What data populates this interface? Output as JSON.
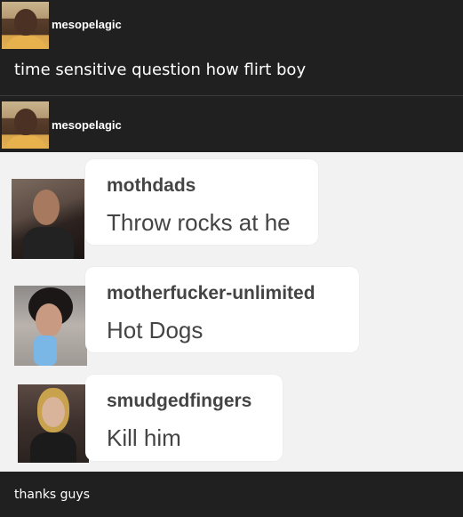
{
  "posts": [
    {
      "username": "mesopelagic",
      "text": "time sensitive question how flirt boy"
    },
    {
      "username": "mesopelagic"
    }
  ],
  "replies": [
    {
      "username": "mothdads",
      "message": "Throw rocks at he"
    },
    {
      "username": "motherfucker-unlimited",
      "message": "Hot Dogs"
    },
    {
      "username": "smudgedfingers",
      "message": "Kill him"
    }
  ],
  "footer": {
    "text": "thanks guys"
  },
  "colors": {
    "background": "#202020",
    "panel": "#f2f2f2",
    "bubble": "#ffffff",
    "text_dark": "#444444"
  }
}
